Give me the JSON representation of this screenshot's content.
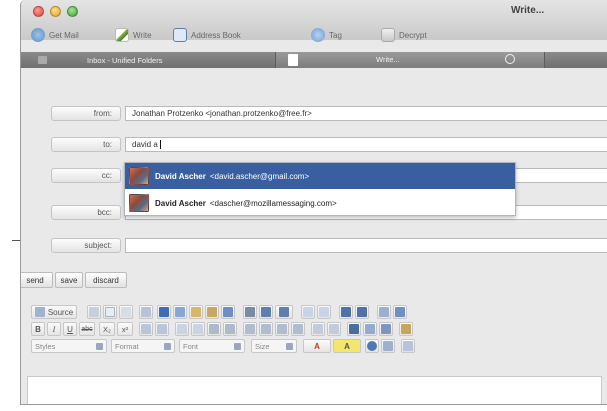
{
  "window": {
    "title": "Write..."
  },
  "toolbar": {
    "items": [
      {
        "label": "Get Mail",
        "icon": "get-mail-icon"
      },
      {
        "label": "Write",
        "icon": "write-icon"
      },
      {
        "label": "Address Book",
        "icon": "address-book-icon"
      },
      {
        "label": "Tag",
        "icon": "tag-icon"
      },
      {
        "label": "Decrypt",
        "icon": "decrypt-icon"
      }
    ]
  },
  "tabs": [
    {
      "label": "Inbox - Unified Folders"
    },
    {
      "label": "Write..."
    }
  ],
  "headers": {
    "from": {
      "label": "from:",
      "value": "Jonathan Protzenko <jonathan.protzenko@free.fr>"
    },
    "to": {
      "label": "to:",
      "value": "david a"
    },
    "cc": {
      "label": "cc:",
      "value": ""
    },
    "bcc": {
      "label": "bcc:",
      "value": ""
    },
    "subject": {
      "label": "subject:",
      "value": ""
    }
  },
  "autocomplete": {
    "items": [
      {
        "name": "David Ascher",
        "address": "<david.ascher@gmail.com>",
        "selected": true
      },
      {
        "name": "David Ascher",
        "address": "<dascher@mozillamessaging.com>",
        "selected": false
      }
    ]
  },
  "actions": {
    "send": "send",
    "save": "save",
    "discard": "discard"
  },
  "editor_toolbar": {
    "source_label": "Source",
    "bold": "B",
    "italic": "I",
    "underline": "U",
    "strike": "abc",
    "subscript": "X₂",
    "superscript": "x²",
    "styles_placeholder": "Styles",
    "format_placeholder": "Format",
    "font_placeholder": "Font",
    "size_placeholder": "Size",
    "text_color": "A",
    "bg_color": "A"
  },
  "colors": {
    "selection": "#3a5fa0",
    "tabbar": "#7c7c7c",
    "window_bg": "#e9e9e9"
  }
}
